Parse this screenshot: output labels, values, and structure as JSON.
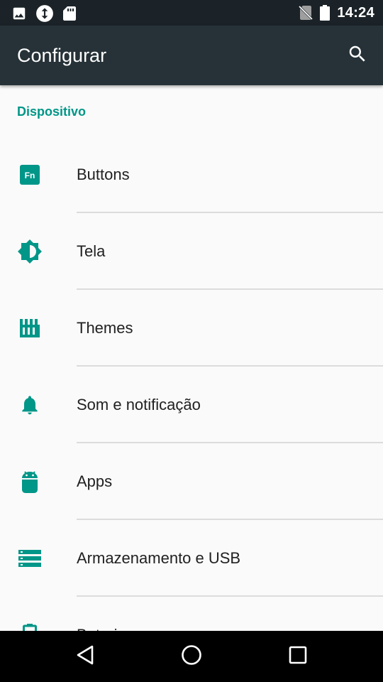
{
  "status_bar": {
    "time": "14:24",
    "left_icons": [
      "image-icon",
      "sync-icon",
      "sd-card-icon"
    ],
    "right_icons": [
      "no-sim-icon",
      "battery-icon"
    ]
  },
  "app_bar": {
    "title": "Configurar",
    "search_icon": "search-icon"
  },
  "colors": {
    "accent": "#009688",
    "app_bar": "#263238",
    "status_bar": "#1b2328",
    "background": "#fafafa"
  },
  "section": {
    "title": "Dispositivo"
  },
  "items": [
    {
      "label": "Buttons",
      "icon": "fn-key-icon"
    },
    {
      "label": "Tela",
      "icon": "brightness-icon"
    },
    {
      "label": "Themes",
      "icon": "themes-icon"
    },
    {
      "label": "Som e notificação",
      "icon": "bell-icon"
    },
    {
      "label": "Apps",
      "icon": "android-icon"
    },
    {
      "label": "Armazenamento e USB",
      "icon": "storage-icon"
    },
    {
      "label": "Bateria",
      "icon": "battery-icon"
    }
  ],
  "nav_bar": {
    "buttons": [
      "back-icon",
      "home-icon",
      "recents-icon"
    ]
  }
}
